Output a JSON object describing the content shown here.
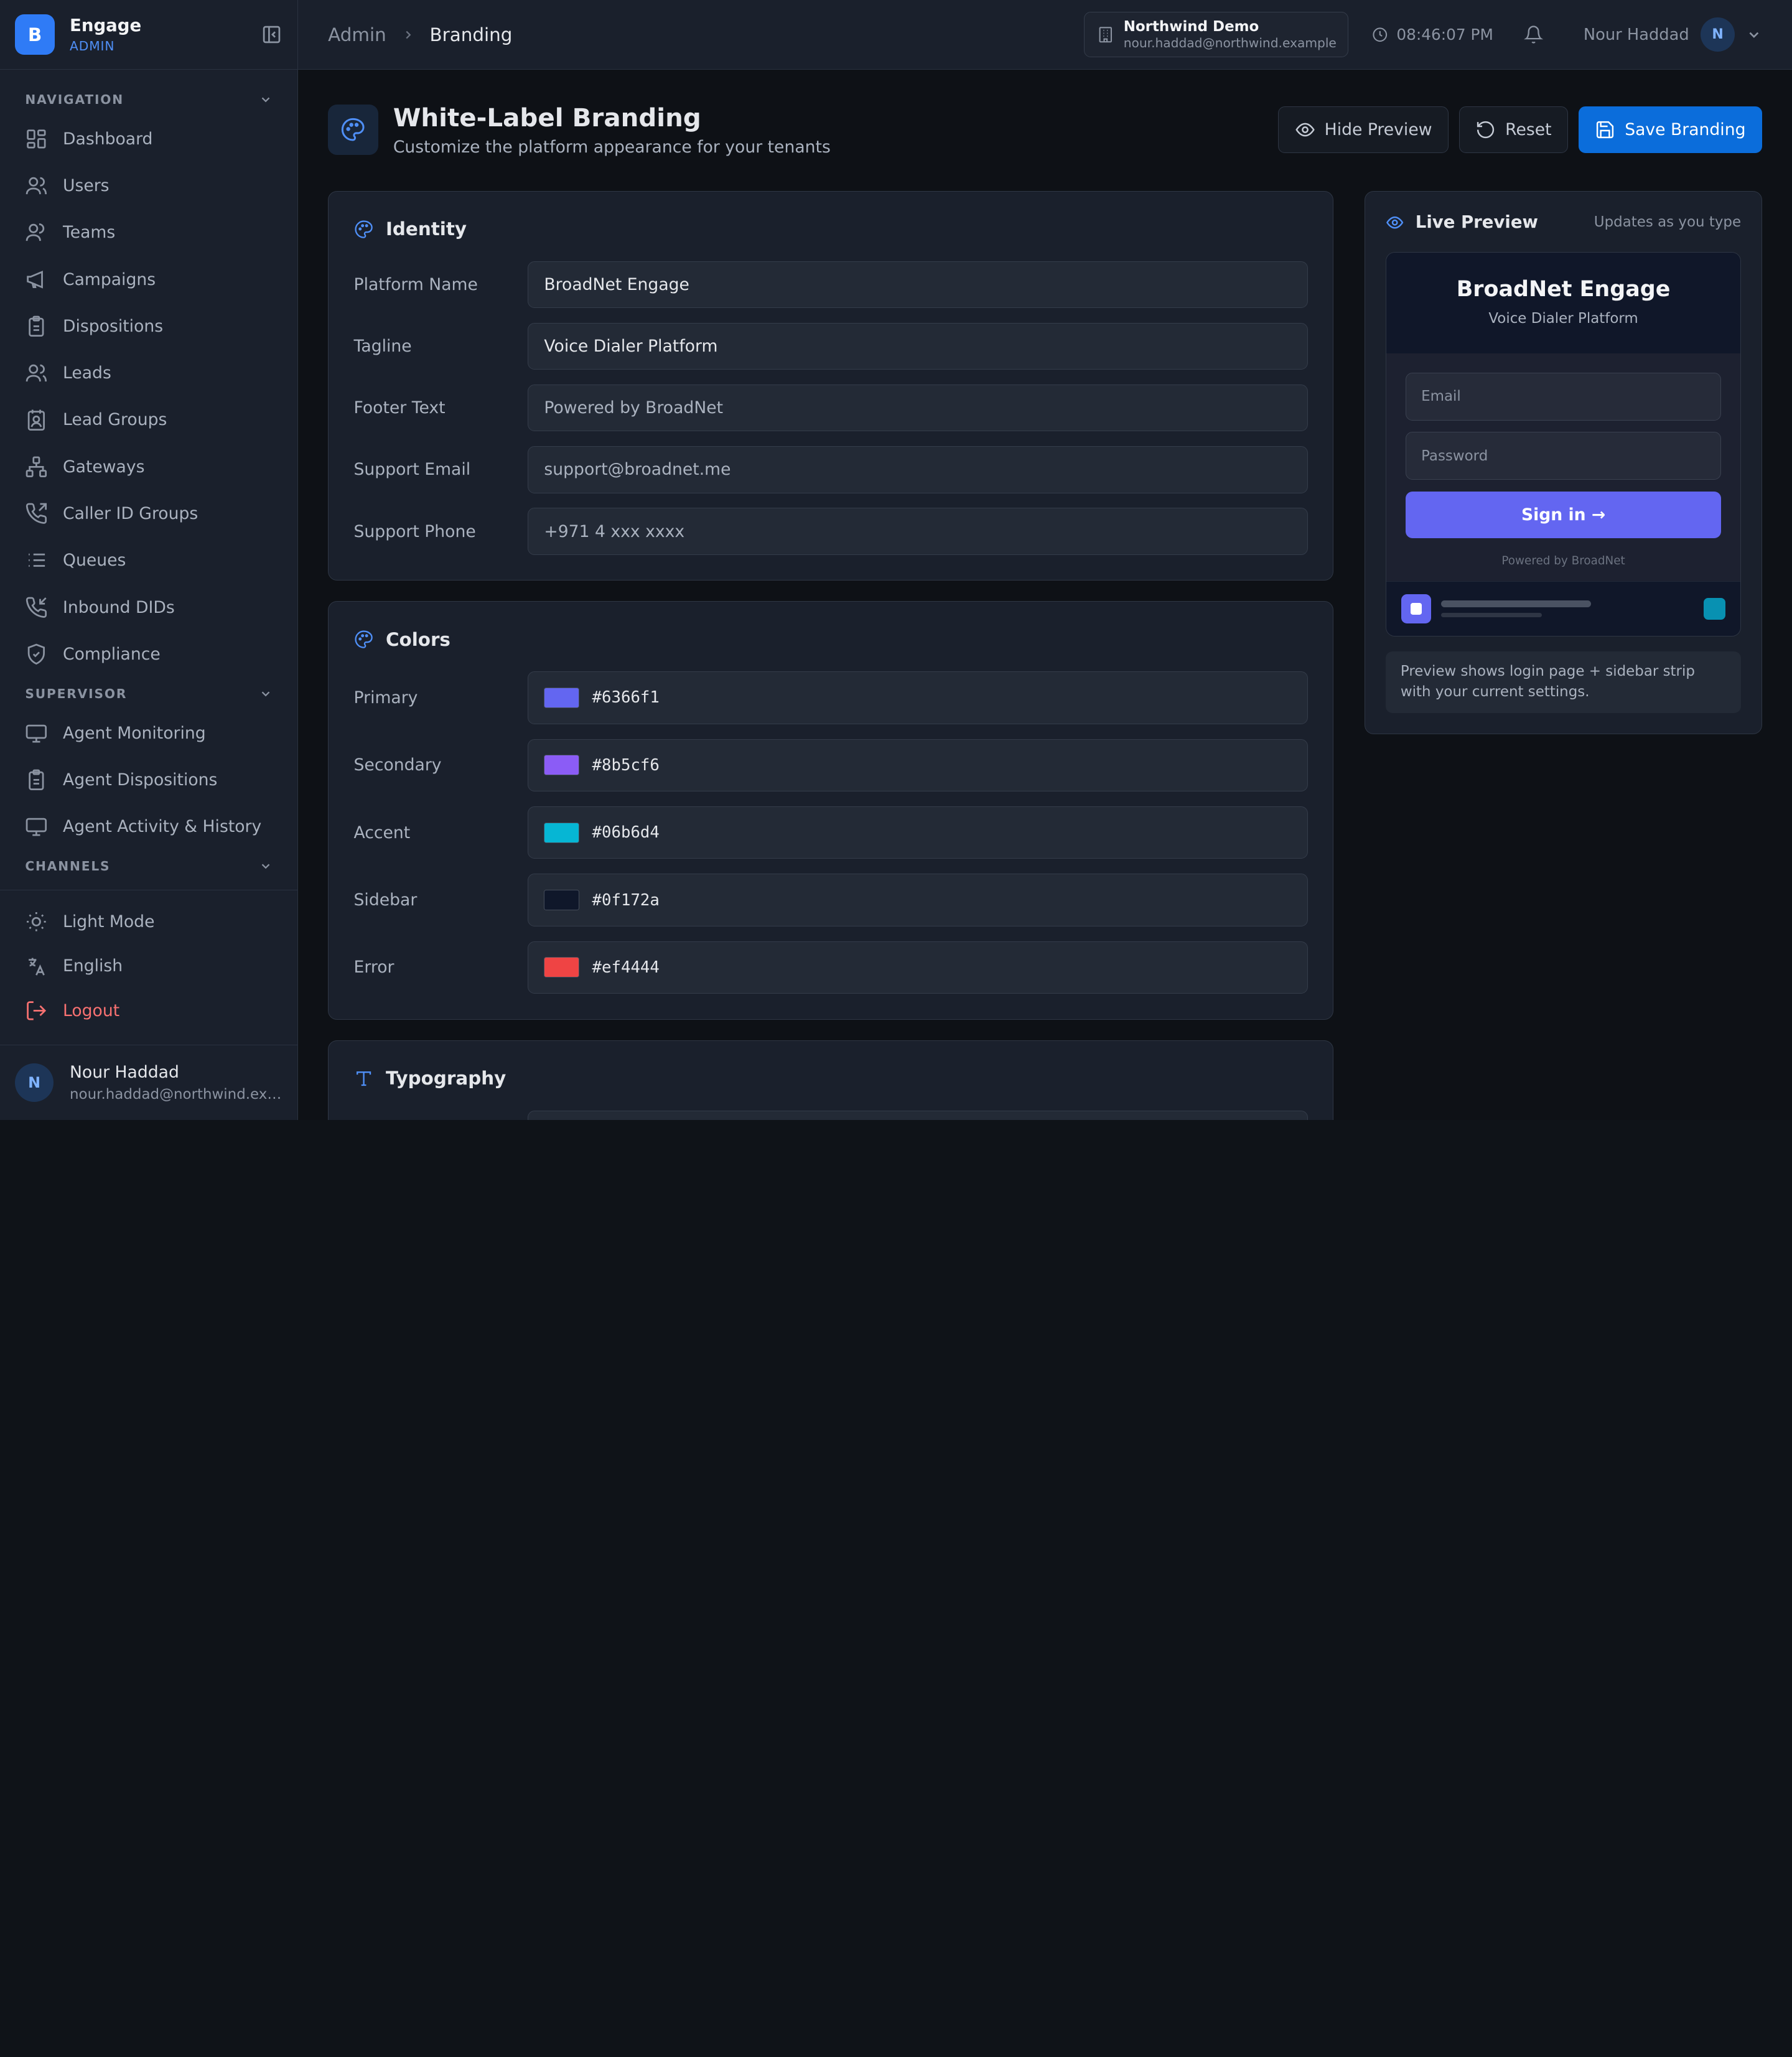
{
  "brand": {
    "logo_letter": "B",
    "name": "Engage",
    "role": "ADMIN"
  },
  "sidebar": {
    "sections": [
      {
        "title": "NAVIGATION",
        "items": [
          {
            "label": "Dashboard",
            "icon": "grid-icon"
          },
          {
            "label": "Users",
            "icon": "users-icon"
          },
          {
            "label": "Teams",
            "icon": "team-icon"
          },
          {
            "label": "Campaigns",
            "icon": "megaphone-icon"
          },
          {
            "label": "Dispositions",
            "icon": "clipboard-icon"
          },
          {
            "label": "Leads",
            "icon": "users-icon"
          },
          {
            "label": "Lead Groups",
            "icon": "contact-book-icon"
          },
          {
            "label": "Gateways",
            "icon": "network-icon"
          },
          {
            "label": "Caller ID Groups",
            "icon": "phone-outgoing-icon"
          },
          {
            "label": "Queues",
            "icon": "list-icon"
          },
          {
            "label": "Inbound DIDs",
            "icon": "phone-incoming-icon"
          },
          {
            "label": "Compliance",
            "icon": "shield-check-icon"
          }
        ]
      },
      {
        "title": "SUPERVISOR",
        "items": [
          {
            "label": "Agent Monitoring",
            "icon": "monitor-icon"
          },
          {
            "label": "Agent Dispositions",
            "icon": "clipboard-icon"
          },
          {
            "label": "Agent Activity & History",
            "icon": "monitor-icon"
          }
        ]
      },
      {
        "title": "CHANNELS",
        "items": []
      }
    ],
    "bottom": {
      "light_mode": "Light Mode",
      "language": "English",
      "logout": "Logout"
    },
    "user": {
      "initial": "N",
      "name": "Nour Haddad",
      "email": "nour.haddad@northwind.example"
    }
  },
  "topbar": {
    "breadcrumb_root": "Admin",
    "breadcrumb_current": "Branding",
    "tenant_name": "Northwind Demo",
    "tenant_email": "nour.haddad@northwind.example",
    "time": "08:46:07 PM",
    "user_name": "Nour Haddad",
    "user_initial": "N"
  },
  "page": {
    "title": "White-Label Branding",
    "subtitle": "Customize the platform appearance for your tenants",
    "hide_preview": "Hide Preview",
    "reset": "Reset",
    "save": "Save Branding"
  },
  "identity": {
    "title": "Identity",
    "fields": [
      {
        "label": "Platform Name",
        "value": "BroadNet Engage"
      },
      {
        "label": "Tagline",
        "value": "Voice Dialer Platform"
      },
      {
        "label": "Footer Text",
        "placeholder": "Powered by BroadNet"
      },
      {
        "label": "Support Email",
        "placeholder": "support@broadnet.me"
      },
      {
        "label": "Support Phone",
        "placeholder": "+971 4 xxx xxxx"
      }
    ]
  },
  "colors": {
    "title": "Colors",
    "items": [
      {
        "label": "Primary",
        "hex": "#6366f1"
      },
      {
        "label": "Secondary",
        "hex": "#8b5cf6"
      },
      {
        "label": "Accent",
        "hex": "#06b6d4"
      },
      {
        "label": "Sidebar",
        "hex": "#0f172a"
      },
      {
        "label": "Error",
        "hex": "#ef4444"
      }
    ]
  },
  "typography": {
    "title": "Typography"
  },
  "preview": {
    "title": "Live Preview",
    "hint": "Updates as you type",
    "brand": "BroadNet Engage",
    "tagline": "Voice Dialer Platform",
    "email_placeholder": "Email",
    "password_placeholder": "Password",
    "signin": "Sign in →",
    "footer": "Powered by BroadNet",
    "note": "Preview shows login page + sidebar strip with your current settings."
  }
}
